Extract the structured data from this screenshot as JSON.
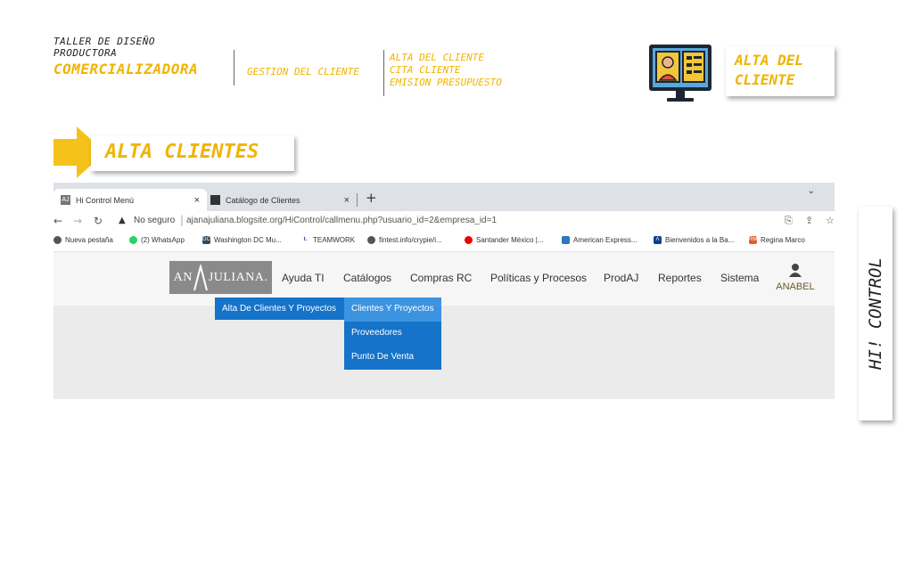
{
  "slide": {
    "company_line1": "TALLER DE DISEÑO",
    "company_line2": "PRODUCTORA",
    "company_line3": "COMERCIALIZADORA",
    "section": "GESTION DEL CLIENTE",
    "submenus": [
      "ALTA DEL CLIENTE",
      "CITA CLIENTE",
      "EMISION PRESUPUESTO"
    ],
    "title_line1": "ALTA DEL",
    "title_line2": "CLIENTE",
    "banner": "ALTA CLIENTES",
    "side_label": "HI! CONTROL",
    "accent_color": "#f0b400"
  },
  "browser": {
    "tabs": [
      {
        "label": "Hi Control Menú",
        "icon": "ajuliana-favicon",
        "close": "×"
      },
      {
        "label": "Catálogo de Clientes",
        "icon": "catalog-favicon",
        "close": "×"
      }
    ],
    "new_tab": "+",
    "address": {
      "security": "No seguro",
      "url": "ajanajuliana.blogsite.org/HiControl/callmenu.php?usuario_id=2&empresa_id=1"
    },
    "bookmarks": [
      "Nueva pestaña",
      "(2) WhatsApp",
      "Washington DC Mu...",
      "TEAMWORK",
      "fintest.info/crypie/i...",
      "Santander México |...",
      "American Express...",
      "Bienvenidos a la Ba...",
      "Regina Marco"
    ]
  },
  "site": {
    "logo_left": "AN",
    "logo_right": "JULIANA.",
    "menu": [
      "Ayuda TI",
      "Catálogos",
      "Compras RC",
      "Políticas y Procesos",
      "ProdAJ",
      "Reportes",
      "Sistema"
    ],
    "user_name": "ANABEL",
    "dropdown_level1": "Alta De Clientes Y Proyectos",
    "dropdown_level2": [
      "Clientes Y Proyectos",
      "Proveedores",
      "Punto De Venta"
    ],
    "menu_color": "#1573c9",
    "menu_highlight": "#3c93e0"
  }
}
